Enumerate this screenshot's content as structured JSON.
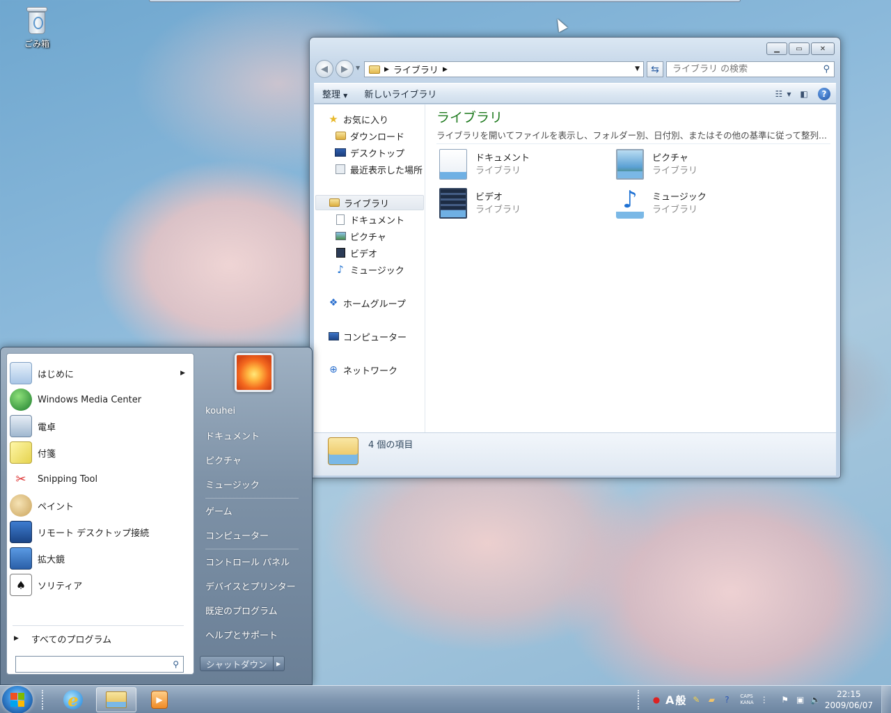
{
  "desktop": {
    "recycle_bin_label": "ごみ箱"
  },
  "explorer": {
    "address": {
      "segment": "ライブラリ"
    },
    "search_placeholder": "ライブラリ の検索",
    "toolbar": {
      "organize": "整理",
      "new_library": "新しいライブラリ"
    },
    "nav": {
      "favorites": "お気に入り",
      "downloads": "ダウンロード",
      "desktop": "デスクトップ",
      "recent": "最近表示した場所",
      "libraries": "ライブラリ",
      "documents": "ドキュメント",
      "pictures": "ピクチャ",
      "videos": "ビデオ",
      "music": "ミュージック",
      "homegroup": "ホームグループ",
      "computer": "コンピューター",
      "network": "ネットワーク"
    },
    "content": {
      "title": "ライブラリ",
      "description": "ライブラリを開いてファイルを表示し、フォルダー別、日付別、またはその他の基準に従って整列...",
      "items": [
        {
          "name": "ドキュメント",
          "type": "ライブラリ",
          "icon": "documents-library-icon"
        },
        {
          "name": "ピクチャ",
          "type": "ライブラリ",
          "icon": "pictures-library-icon"
        },
        {
          "name": "ビデオ",
          "type": "ライブラリ",
          "icon": "videos-library-icon"
        },
        {
          "name": "ミュージック",
          "type": "ライブラリ",
          "icon": "music-library-icon"
        }
      ]
    },
    "details": {
      "count_text": "4 個の項目"
    }
  },
  "start_menu": {
    "programs": [
      {
        "label": "はじめに",
        "icon": "getting-started-icon",
        "has_submenu": true
      },
      {
        "label": "Windows Media Center",
        "icon": "media-center-icon"
      },
      {
        "label": "電卓",
        "icon": "calculator-icon"
      },
      {
        "label": "付箋",
        "icon": "sticky-notes-icon"
      },
      {
        "label": "Snipping Tool",
        "icon": "snipping-tool-icon"
      },
      {
        "label": "ペイント",
        "icon": "paint-icon"
      },
      {
        "label": "リモート デスクトップ接続",
        "icon": "remote-desktop-icon"
      },
      {
        "label": "拡大鏡",
        "icon": "magnifier-icon"
      },
      {
        "label": "ソリティア",
        "icon": "solitaire-icon"
      }
    ],
    "all_programs": "すべてのプログラム",
    "user_name": "kouhei",
    "links": {
      "documents": "ドキュメント",
      "pictures": "ピクチャ",
      "music": "ミュージック",
      "games": "ゲーム",
      "computer": "コンピューター",
      "control_panel": "コントロール パネル",
      "devices_printers": "デバイスとプリンター",
      "default_programs": "既定のプログラム",
      "help_support": "ヘルプとサポート"
    },
    "shutdown_label": "シャットダウン"
  },
  "taskbar": {
    "ime_mode": "A",
    "ime_kanji": "般",
    "caps": "CAPS",
    "kana": "KANA",
    "time": "22:15",
    "date": "2009/06/07"
  }
}
